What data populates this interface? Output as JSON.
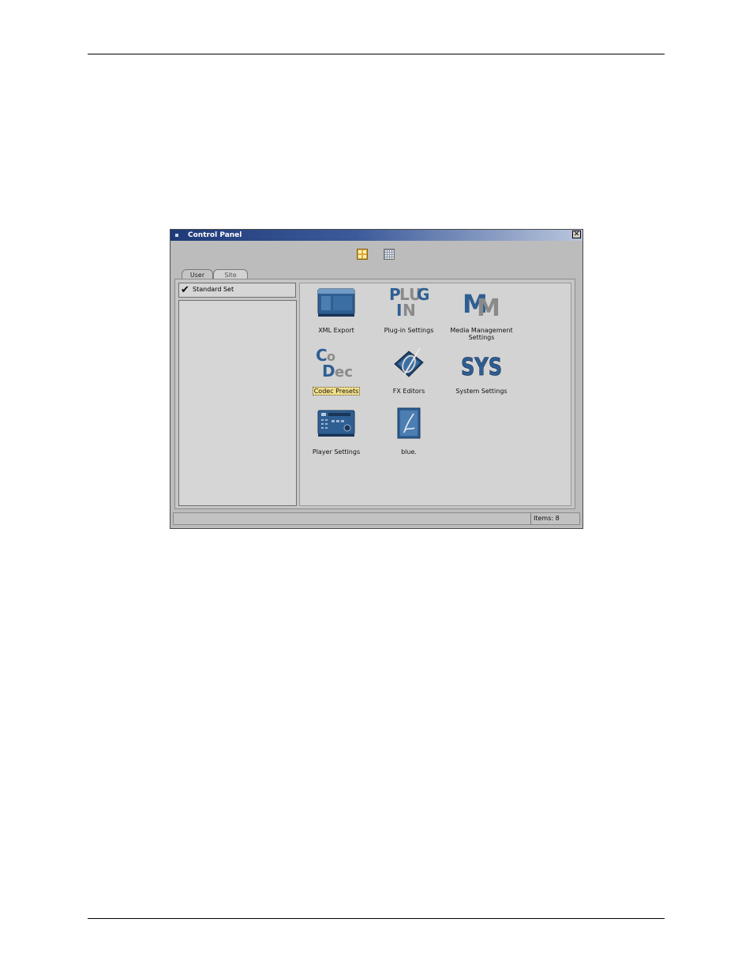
{
  "window": {
    "title": "Control Panel",
    "close_glyph": "✕"
  },
  "view_buttons": [
    {
      "name": "large-icons",
      "icon": "large-icons-icon"
    },
    {
      "name": "small-icons",
      "icon": "small-icons-icon"
    }
  ],
  "tabs": [
    {
      "label": "User"
    },
    {
      "label": "Site"
    }
  ],
  "sets": {
    "current": "Standard Set",
    "check_glyph": "✔"
  },
  "items": [
    {
      "label": "XML Export",
      "icon": "xml-export-icon"
    },
    {
      "label": "Plug-in Settings",
      "icon": "plugin-icon"
    },
    {
      "label": "Media Management Settings",
      "icon": "media-management-icon"
    },
    {
      "label": "Codec Presets",
      "icon": "codec-icon",
      "selected": true
    },
    {
      "label": "FX Editors",
      "icon": "fx-editors-icon"
    },
    {
      "label": "System Settings",
      "icon": "sys-icon"
    },
    {
      "label": "Player Settings",
      "icon": "player-icon"
    },
    {
      "label": "blue.",
      "icon": "blue-icon"
    }
  ],
  "status": {
    "items_count": "Items: 8"
  },
  "colors": {
    "titlebar_start": "#1f3a78",
    "titlebar_end": "#b9c6dd",
    "icon_blue": "#2f5f92",
    "selection": "#f4e08a"
  }
}
